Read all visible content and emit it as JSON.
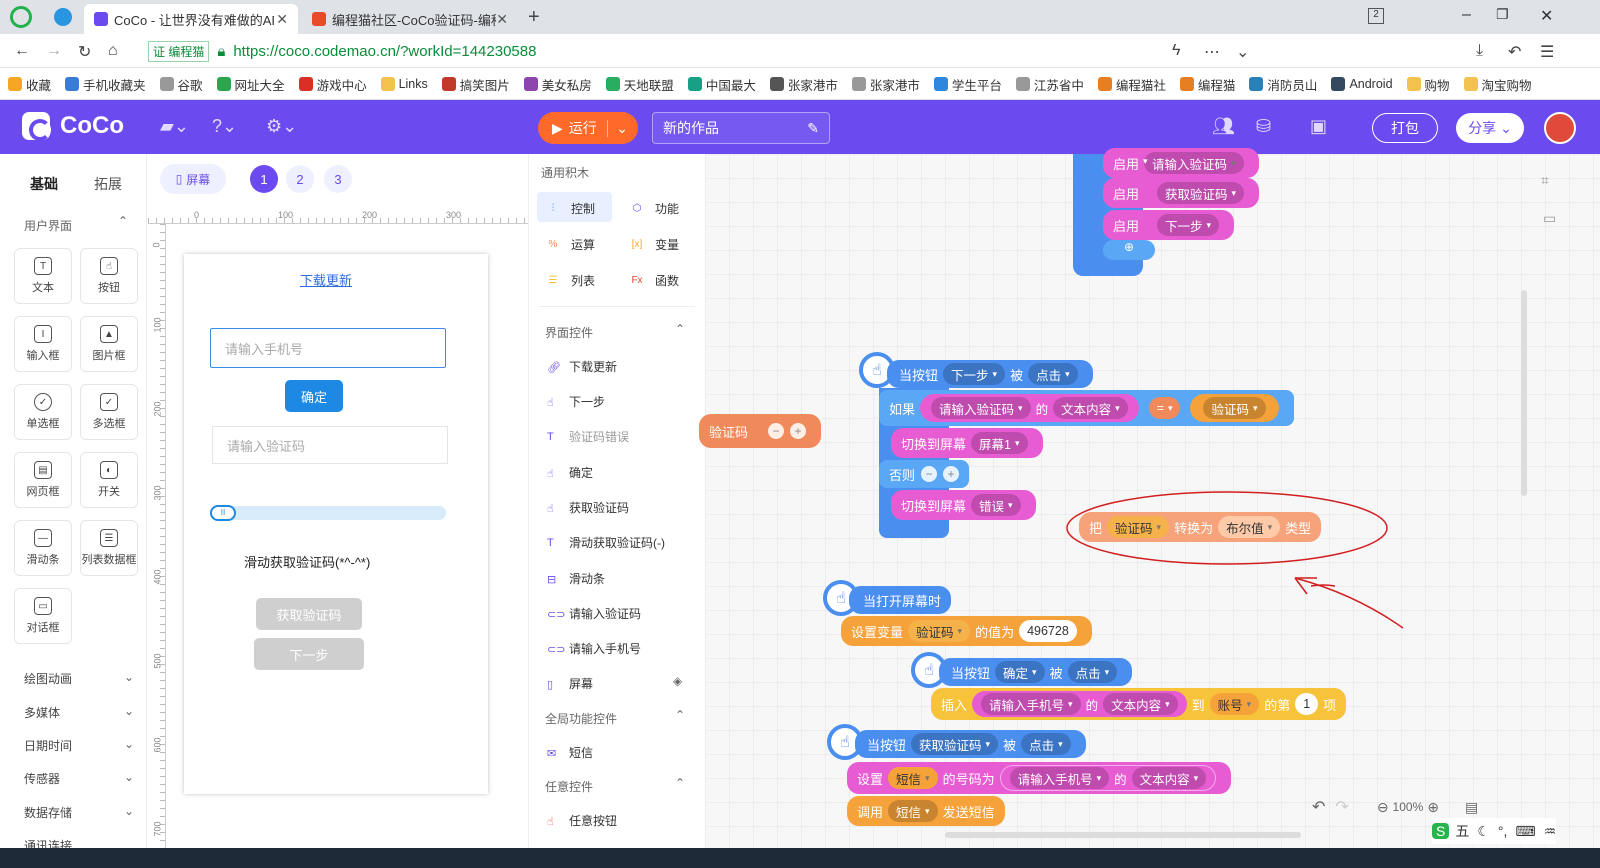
{
  "browser": {
    "tabs": [
      {
        "label": "CoCo - 让世界没有难做的APP",
        "active": true
      },
      {
        "label": "编程猫社区-CoCo验证码-编程",
        "active": false
      }
    ],
    "tab_counter": "2",
    "url": "https://coco.codemao.cn/?workId=144230588",
    "site_badge": "证 编程猫",
    "bookmarks": [
      "收藏",
      "手机收藏夹",
      "谷歌",
      "网址大全",
      "游戏中心",
      "Links",
      "搞笑图片",
      "美女私房",
      "天地联盟",
      "中国最大",
      "张家港市",
      "张家港市",
      "学生平台",
      "江苏省中",
      "编程猫社",
      "编程猫",
      "消防员山",
      "Android",
      "购物",
      "淘宝购物"
    ]
  },
  "app": {
    "logo": "CoCo",
    "run_label": "运行",
    "project_title": "新的作品",
    "pack_label": "打包",
    "share_label": "分享",
    "accent": "#6b4bf0"
  },
  "left_panel": {
    "tabs": [
      "基础",
      "拓展"
    ],
    "section_ui": "用户界面",
    "components": [
      "文本",
      "按钮",
      "输入框",
      "图片框",
      "单选框",
      "多选框",
      "网页框",
      "开关",
      "滑动条",
      "列表数据框",
      "对话框"
    ],
    "categories": [
      "绘图动画",
      "多媒体",
      "日期时间",
      "传感器",
      "数据存储",
      "通讯连接"
    ]
  },
  "stage": {
    "screen_label": "屏幕",
    "pages": [
      "1",
      "2",
      "3"
    ],
    "ruler_x": [
      "0",
      "100",
      "200",
      "300"
    ],
    "ruler_y": [
      "0",
      "100",
      "200",
      "300",
      "400",
      "500",
      "600",
      "700"
    ],
    "phone": {
      "download_link": "下载更新",
      "phone_placeholder": "请输入手机号",
      "confirm_btn": "确定",
      "code_placeholder": "请输入验证码",
      "slide_text": "滑动获取验证码(*^-^*)",
      "get_code_btn": "获取验证码",
      "next_btn": "下一步"
    }
  },
  "palette": {
    "title": "通用积木",
    "cats": [
      "控制",
      "功能",
      "运算",
      "变量",
      "列表",
      "函数"
    ],
    "section_ui": "界面控件",
    "ui_items": [
      "下载更新",
      "下一步",
      "验证码错误",
      "确定",
      "获取验证码",
      "滑动获取验证码(-)",
      "滑动条",
      "请输入验证码",
      "请输入手机号",
      "屏幕"
    ],
    "section_global": "全局功能控件",
    "global_items": [
      "短信"
    ],
    "section_any": "任意控件",
    "any_items": [
      "任意按钮"
    ]
  },
  "blocks": {
    "enable": "启用",
    "enable_rows": [
      "请输入验证码",
      "获取验证码",
      "下一步"
    ],
    "when_btn": "当按钮",
    "clicked_word": "被",
    "click": "点击",
    "if_word": "如果",
    "input_code": "请输入验证码",
    "of_word": "的",
    "text_content": "文本内容",
    "eq": "=",
    "var_code": "验证码",
    "switch_screen": "切换到屏幕",
    "screen1": "屏幕1",
    "else_word": "否则",
    "err_screen": "错误",
    "ext_var": "验证码",
    "convert": "把",
    "convert_to": "转换为",
    "bool_type": "布尔值",
    "type_word": "类型",
    "when_open": "当打开屏幕时",
    "set_var": "设置变量",
    "value_word": "的值为",
    "value_num": "496728",
    "confirm": "确定",
    "insert": "插入",
    "input_phone": "请输入手机号",
    "to_word": "到",
    "account": "账号",
    "nth": "的第",
    "index": "1",
    "item_word": "项",
    "get_code": "获取验证码",
    "set_word": "设置",
    "sms": "短信",
    "phone_of": "的号码为",
    "call": "调用",
    "send_sms": "发送短信",
    "next": "下一步"
  },
  "zoom": "100%",
  "ime_label": "五"
}
